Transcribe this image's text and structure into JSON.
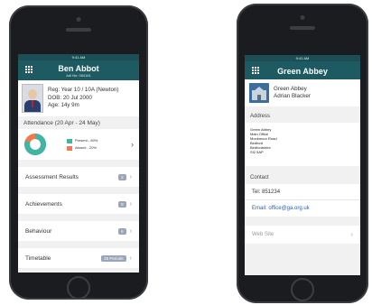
{
  "left": {
    "status_bar": "9:41 AM",
    "title": "Ben Abbot",
    "subtitle": "Adi No: 084161",
    "reg": "Reg: Year 10 / 10A  (Newton)",
    "dob": "DOB: 20 Jul 2000",
    "age": "Age: 14y 9m",
    "attendance_label": "Attendance (20 Apr - 24 May)",
    "legend": [
      {
        "label": "Present - 80%",
        "color": "#3fb5a4"
      },
      {
        "label": "Absent - 20%",
        "color": "#f07a4f"
      }
    ],
    "attendance_fraction_present": 0.8,
    "rows": [
      {
        "label": "Assessment Results",
        "badge": "2"
      },
      {
        "label": "Achievements",
        "badge": "8"
      },
      {
        "label": "Behaviour",
        "badge": "6"
      },
      {
        "label": "Timetable",
        "badge": "25 Periods"
      }
    ]
  },
  "right": {
    "status_bar": "9:41 AM",
    "title": "Green Abbey",
    "school_name": "Green Abbey",
    "contact_name": "Adrian Blacker",
    "address_header": "Address",
    "address_lines": [
      "Green Abbey",
      "Main Office",
      "Monkmoor Road",
      "Bedford",
      "Bedfordshire",
      "SI2 5AP"
    ],
    "contact_header": "Contact",
    "tel": "Tel: 851234",
    "email": "Email: office@ga.org.uk",
    "website": "Web Site"
  }
}
